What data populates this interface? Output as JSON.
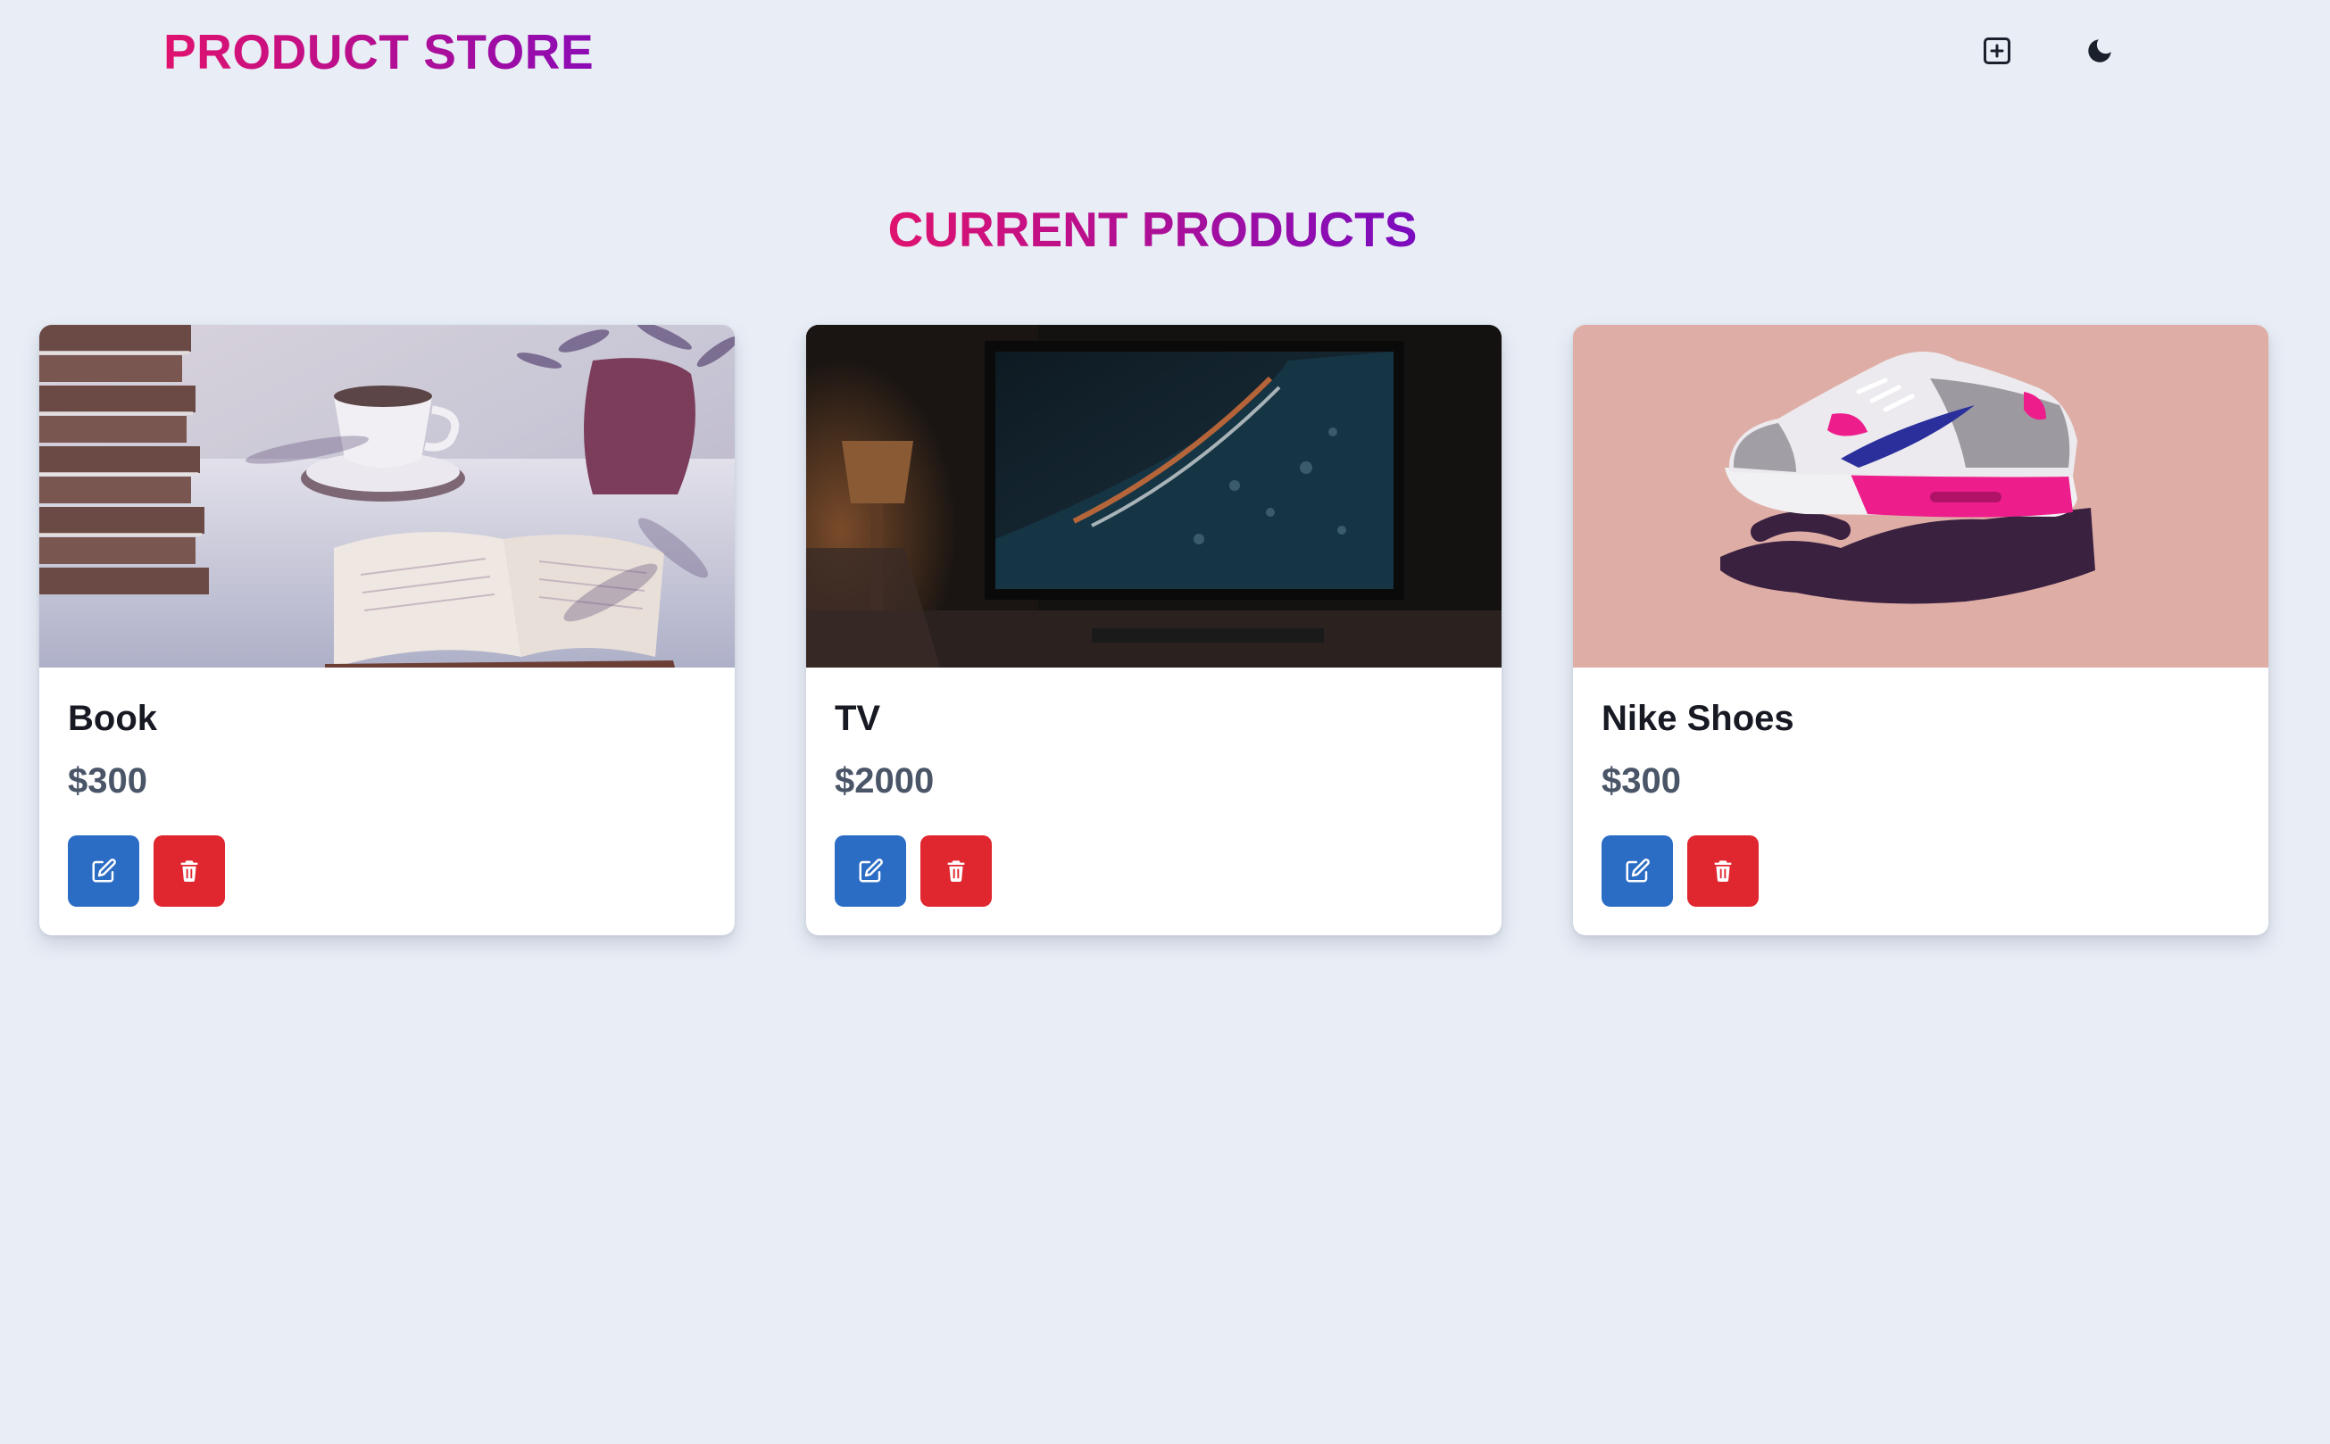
{
  "app": {
    "brand": "PRODUCT STORE"
  },
  "navbar": {
    "add_icon": "plus-square-icon",
    "theme_icon": "moon-icon"
  },
  "main": {
    "title": "CURRENT PRODUCTS"
  },
  "products": [
    {
      "name": "Book",
      "price": "$300",
      "image": "book-photo"
    },
    {
      "name": "TV",
      "price": "$2000",
      "image": "tv-photo"
    },
    {
      "name": "Nike Shoes",
      "price": "$300",
      "image": "shoes-photo"
    }
  ],
  "actions": {
    "edit_icon": "edit-icon",
    "delete_icon": "trash-icon"
  },
  "colors": {
    "gradient_start": "#e0126e",
    "gradient_end": "#8b0bb5",
    "edit_button": "#2b6cc4",
    "delete_button": "#e0262f",
    "background": "#e9eef6"
  }
}
